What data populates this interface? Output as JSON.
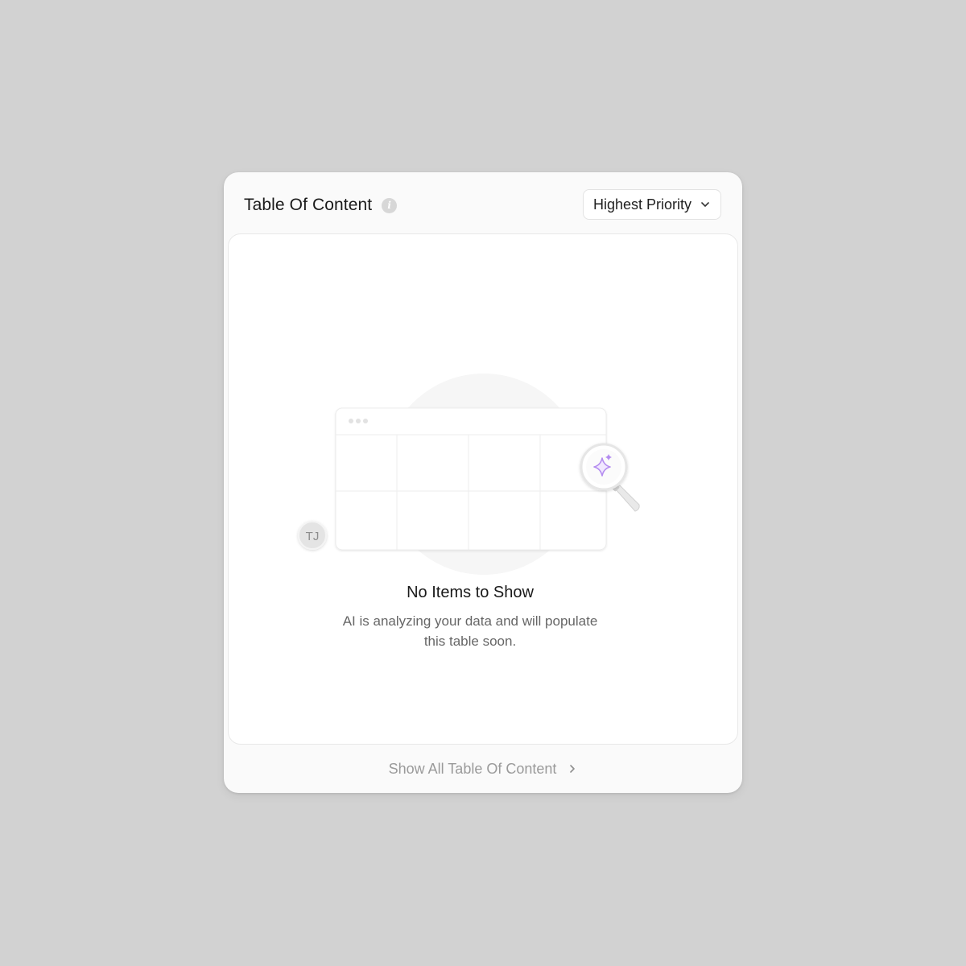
{
  "header": {
    "title": "Table Of Content",
    "info_icon": "info-icon",
    "sort_dropdown": {
      "selected": "Highest Priority",
      "icon": "chevron-down-icon"
    }
  },
  "empty_state": {
    "illustration": {
      "avatar_initials": "TJ",
      "magnifier_icon": "sparkle-magnifier-icon",
      "accent_color": "#b48cf0"
    },
    "title": "No Items to Show",
    "description": "AI is analyzing your data and will populate this table soon."
  },
  "footer": {
    "link_label": "Show All Table Of Content",
    "icon": "chevron-right-icon"
  },
  "colors": {
    "page_background": "#d2d2d2",
    "card_background": "#fafafa",
    "panel_background": "#ffffff"
  }
}
